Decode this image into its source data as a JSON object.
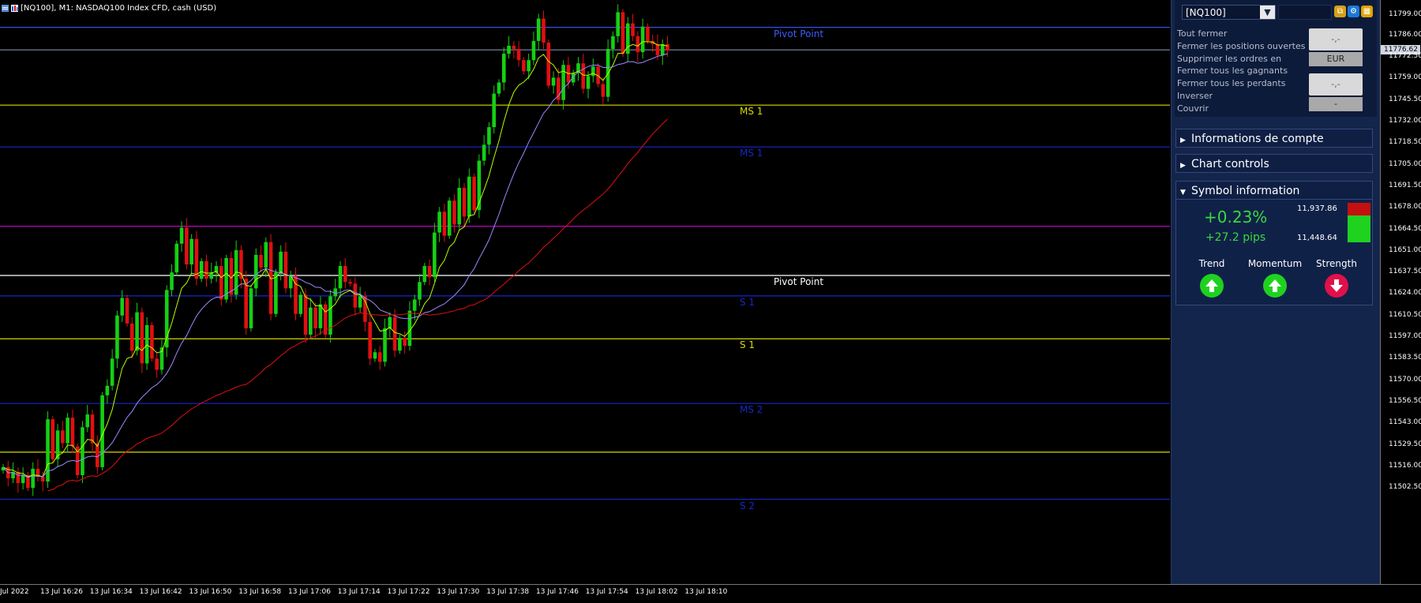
{
  "window": {
    "title": "[NQ100], M1:  NASDAQ100 Index CFD, cash (USD)"
  },
  "levels": [
    {
      "label": "Pivot Point",
      "price": 11790.5,
      "color": "#3a5cff"
    },
    {
      "label": "",
      "price": 11776.4,
      "color": "#7f8aa8"
    },
    {
      "label": "MS 1",
      "price": 11741.8,
      "color": "#d8d800"
    },
    {
      "label": "MS 1",
      "price": 11715.6,
      "color": "#1428c8"
    },
    {
      "label": "",
      "price": 11665.9,
      "color": "#d400d4"
    },
    {
      "label": "Pivot Point",
      "price": 11635.1,
      "color": "#ffffff"
    },
    {
      "label": "S 1",
      "price": 11622.3,
      "color": "#1428c8"
    },
    {
      "label": "S 1",
      "price": 11595.4,
      "color": "#d8d800"
    },
    {
      "label": "MS 2",
      "price": 11554.9,
      "color": "#1428c8"
    },
    {
      "label": "",
      "price": 11524.4,
      "color": "#d8d800"
    },
    {
      "label": "S 2",
      "price": 11494.9,
      "color": "#1428c8"
    }
  ],
  "price_axis": {
    "current_price": "11776.62",
    "labels": [
      "11799.00",
      "11786.00",
      "11772.50",
      "11759.00",
      "11745.50",
      "11732.00",
      "11718.50",
      "11705.00",
      "11691.50",
      "11678.00",
      "11664.50",
      "11651.00",
      "11637.50",
      "11624.00",
      "11610.50",
      "11597.00",
      "11583.50",
      "11570.00",
      "11556.50",
      "11543.00",
      "11529.50",
      "11516.00",
      "11502.50"
    ]
  },
  "time_axis": {
    "labels": [
      "Jul 2022",
      "13 Jul 16:26",
      "13 Jul 16:34",
      "13 Jul 16:42",
      "13 Jul 16:50",
      "13 Jul 16:58",
      "13 Jul 17:06",
      "13 Jul 17:14",
      "13 Jul 17:22",
      "13 Jul 17:30",
      "13 Jul 17:38",
      "13 Jul 17:46",
      "13 Jul 17:54",
      "13 Jul 18:02",
      "13 Jul 18:10"
    ]
  },
  "chart_data": {
    "type": "candlestick",
    "symbol": "NQ100",
    "timeframe": "M1",
    "y_range": [
      11490,
      11805
    ],
    "closes": [
      11515,
      11508,
      11512,
      11505,
      11510,
      11502,
      11514,
      11509,
      11506,
      11545,
      11520,
      11538,
      11530,
      11546,
      11528,
      11510,
      11540,
      11548,
      11530,
      11515,
      11560,
      11566,
      11583,
      11610,
      11621,
      11605,
      11588,
      11612,
      11580,
      11604,
      11583,
      11576,
      11590,
      11626,
      11637,
      11655,
      11665,
      11642,
      11658,
      11633,
      11644,
      11633,
      11637,
      11641,
      11620,
      11646,
      11623,
      11651,
      11633,
      11602,
      11627,
      11648,
      11640,
      11656,
      11611,
      11637,
      11650,
      11627,
      11635,
      11611,
      11623,
      11598,
      11615,
      11602,
      11617,
      11598,
      11622,
      11627,
      11641,
      11631,
      11630,
      11615,
      11622,
      11606,
      11583,
      11587,
      11581,
      11602,
      11609,
      11588,
      11596,
      11591,
      11613,
      11620,
      11631,
      11641,
      11634,
      11662,
      11675,
      11660,
      11682,
      11667,
      11690,
      11672,
      11697,
      11676,
      11707,
      11717,
      11728,
      11749,
      11756,
      11774,
      11779,
      11777,
      11770,
      11763,
      11770,
      11782,
      11796,
      11781,
      11754,
      11759,
      11745,
      11767,
      11756,
      11762,
      11768,
      11752,
      11760,
      11766,
      11755,
      11747,
      11777,
      11785,
      11800,
      11774,
      11793,
      11785,
      11775,
      11791,
      11782,
      11780,
      11773,
      11780,
      11776
    ],
    "ema_fast_color": "#b5ff00",
    "ema_mid_color": "#9a8cff",
    "ema_slow_color": "#e01010",
    "up_color": "#14d014",
    "down_color": "#e01010"
  },
  "panel": {
    "symbol_select": "[NQ100]",
    "actions": [
      "Tout fermer",
      "Fermer les positions ouvertes",
      "Supprimer les ordres en",
      "Fermer tous les gagnants",
      "Fermer tous les perdants",
      "Inverser",
      "Couvrir"
    ],
    "price_box_top": "-,-",
    "currency": "EUR",
    "price_box_bottom": "-,-",
    "dash": "-",
    "sections": [
      "Informations de compte",
      "Chart controls",
      "Symbol information"
    ],
    "symbol_info": {
      "change_pct": "+0.23%",
      "change_pips": "+27.2 pips",
      "high": "11,937.86",
      "low": "11,448.64",
      "indicators": [
        {
          "label": "Trend",
          "direction": "up",
          "color": "#1fd21f"
        },
        {
          "label": "Momentum",
          "direction": "up",
          "color": "#1fd21f"
        },
        {
          "label": "Strength",
          "direction": "down",
          "color": "#e0104a"
        }
      ]
    }
  }
}
